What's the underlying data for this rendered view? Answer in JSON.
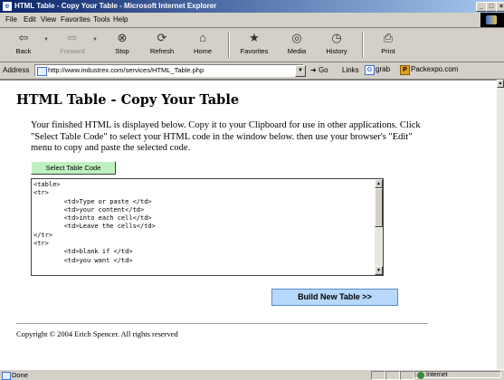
{
  "window": {
    "title": "HTML Table - Copy Your Table - Microsoft Internet Explorer",
    "controls": [
      "_",
      "□",
      "×"
    ]
  },
  "menu": [
    "File",
    "Edit",
    "View",
    "Favorites",
    "Tools",
    "Help"
  ],
  "toolbar": {
    "buttons": [
      {
        "label": "Back",
        "icon": "back-arrow-icon",
        "glyph": "⇦"
      },
      {
        "label": "Forward",
        "icon": "forward-arrow-icon",
        "glyph": "⇨"
      },
      {
        "label": "Stop",
        "icon": "stop-icon",
        "glyph": "⊗"
      },
      {
        "label": "Refresh",
        "icon": "refresh-icon",
        "glyph": "⟳"
      },
      {
        "label": "Home",
        "icon": "home-icon",
        "glyph": "⌂"
      },
      {
        "label": "Favorites",
        "icon": "favorites-icon",
        "glyph": "★"
      },
      {
        "label": "Media",
        "icon": "media-icon",
        "glyph": "◎"
      },
      {
        "label": "History",
        "icon": "history-icon",
        "glyph": "◷"
      },
      {
        "label": "Print",
        "icon": "print-icon",
        "glyph": "⎙"
      }
    ]
  },
  "address": {
    "label": "Address",
    "url": "http://www.industrex.com/services/HTML_Table.php",
    "go": "Go",
    "links_label": "Links",
    "links": [
      "grab",
      "Packexpo.com"
    ]
  },
  "page": {
    "heading": "HTML Table - Copy Your Table",
    "intro": "Your finished HTML is displayed below. Copy it to your Clipboard for use in other applications. Click \"Select Table Code\" to select your HTML code in the window below. then use your browser's \"Edit\" menu to copy and paste the selected code.",
    "select_button": "Select Table Code",
    "code": "<table>\n<tr>\n        <td>Type or paste </td>\n        <td>your content</td>\n        <td>into each cell</td>\n        <td>Leave the cells</td>\n</tr>\n<tr>\n        <td>blank if </td>\n        <td>you want </td>",
    "build_button": "Build New Table >>",
    "copyright": "Copyright © 2004 Erich Spencer. All rights reserved"
  },
  "status": {
    "text": "Done",
    "zone": "Internet"
  }
}
